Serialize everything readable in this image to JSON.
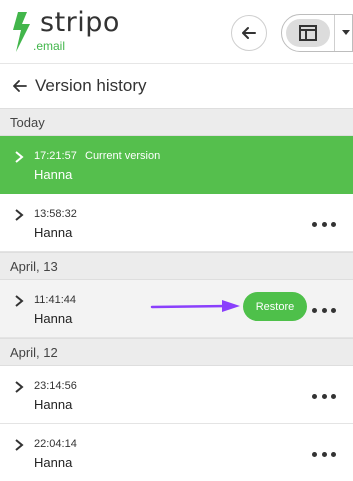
{
  "header": {
    "logo_text": "stripo",
    "logo_sub": ".email",
    "back_icon": "arrow-left-icon",
    "view_icon": "panel-layout-icon",
    "view_caret_icon": "caret-down-icon"
  },
  "page": {
    "title": "Version history",
    "back_icon": "arrow-left-icon"
  },
  "sections": [
    {
      "label": "Today"
    },
    {
      "label": "April, 13"
    },
    {
      "label": "April, 12"
    }
  ],
  "versions": [
    {
      "time": "17:21:57",
      "current_label": "Current version",
      "user": "Hanna"
    },
    {
      "time": "13:58:32",
      "user": "Hanna"
    },
    {
      "time": "11:41:44",
      "user": "Hanna",
      "restore_label": "Restore"
    },
    {
      "time": "23:14:56",
      "user": "Hanna"
    },
    {
      "time": "22:04:14",
      "user": "Hanna"
    }
  ],
  "colors": {
    "accent": "#55bf4d",
    "annotation": "#8a3ffc"
  }
}
